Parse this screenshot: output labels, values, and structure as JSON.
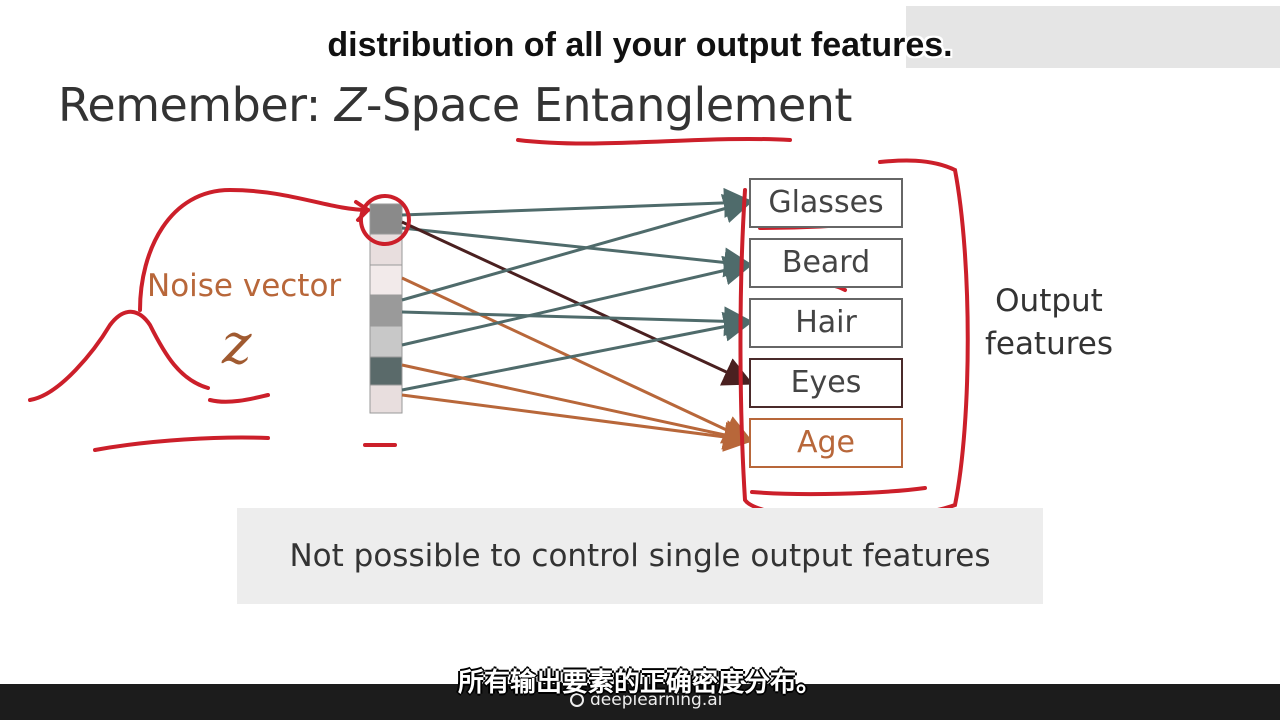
{
  "title": {
    "prefix": "Remember: ",
    "z": "Z",
    "rest": "-Space Entanglement"
  },
  "subtitle_en": "distribution of all your output features.",
  "subtitle_zh": "所有输出要素的正确密度分布。",
  "noise": {
    "label": "Noise vector",
    "symbol": "z"
  },
  "features": [
    {
      "label": "Glasses",
      "color": "#666666"
    },
    {
      "label": "Beard",
      "color": "#666666"
    },
    {
      "label": "Hair",
      "color": "#666666"
    },
    {
      "label": "Eyes",
      "color": "#4a2a2a"
    },
    {
      "label": "Age",
      "color": "#b8673a"
    }
  ],
  "output_label": [
    "Output",
    "features"
  ],
  "caption": "Not possible to control single output features",
  "brand": "deeplearning.ai",
  "colors": {
    "arrow_gray": "#4f6b6b",
    "arrow_brown": "#b8673a",
    "arrow_dark": "#4a2020",
    "annotation_red": "#cc1f2a",
    "cells": [
      "#8a8a8a",
      "#e8dede",
      "#f2eaea",
      "#9a9a9a",
      "#c8c8c8",
      "#5a6a6a",
      "#e8dede"
    ]
  }
}
